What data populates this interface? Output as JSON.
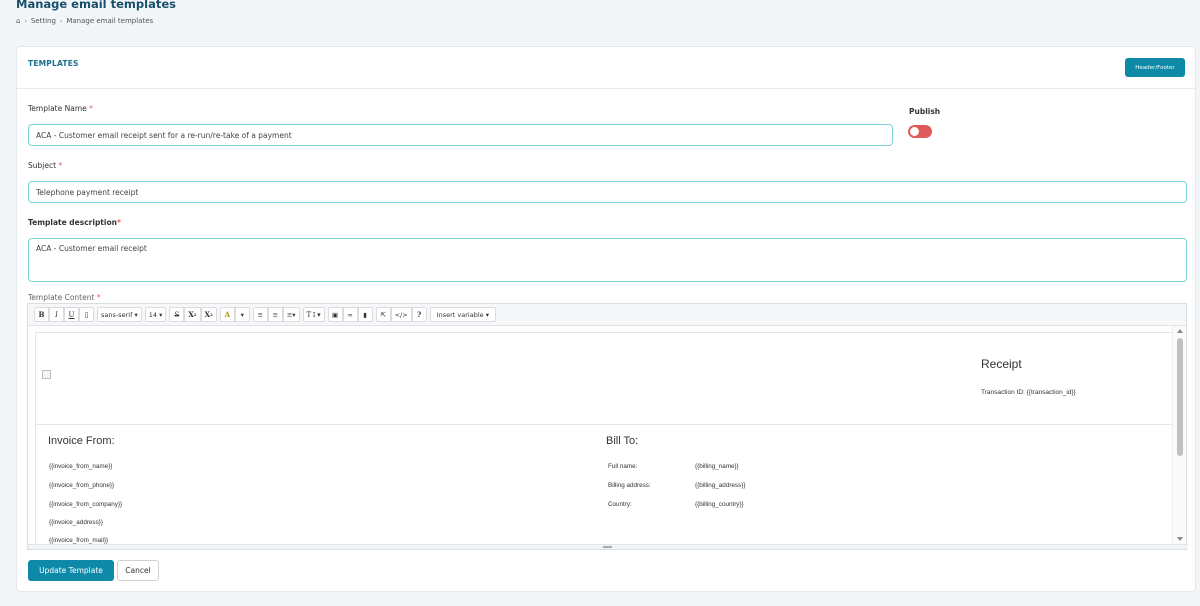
{
  "page": {
    "title": "Manage email templates",
    "breadcrumb": [
      "Setting",
      "Manage email templates"
    ]
  },
  "card": {
    "title": "TEMPLATES",
    "header_footer_button": "Header/Footer"
  },
  "form": {
    "template_name_label": "Template Name",
    "template_name_value": "ACA - Customer email receipt sent for a re-run/re-take of a payment",
    "publish_label": "Publish",
    "publish_state": "off",
    "subject_label": "Subject",
    "subject_value": "Telephone payment receipt",
    "description_label": "Template description",
    "description_value": "ACA - Customer email receipt",
    "content_label": "Template Content",
    "required_marker": "*"
  },
  "toolbar": {
    "bold": "B",
    "italic": "I",
    "underline": "U",
    "font_family": "sans-serif",
    "font_size": "14",
    "strikethrough": "S",
    "superscript": "X",
    "subscript": "X",
    "highlight": "A",
    "code_view": "</>",
    "help": "?",
    "insert_variable": "Insert variable"
  },
  "template": {
    "receipt_title": "Receipt",
    "transaction": "Transaction ID: {{transaction_id}}",
    "invoice_from_title": "Invoice From:",
    "invoice_from_fields": [
      "{{invoice_from_name}}",
      "{{invoice_from_phone}}",
      "{{invoice_from_company}}",
      "{{invoice_address}}",
      "{{invoice_from_mail}}"
    ],
    "bill_to_title": "Bill To:",
    "bill_to_rows": [
      {
        "label": "Full name:",
        "value": "{{billing_name}}"
      },
      {
        "label": "Billing address:",
        "value": "{{billing_address}}"
      },
      {
        "label": "Country:",
        "value": "{{billing_country}}"
      }
    ]
  },
  "actions": {
    "update": "Update Template",
    "cancel": "Cancel"
  },
  "colors": {
    "accent": "#0e8aa8",
    "title": "#1a4f6b",
    "toggle_off": "#e05a5a"
  }
}
